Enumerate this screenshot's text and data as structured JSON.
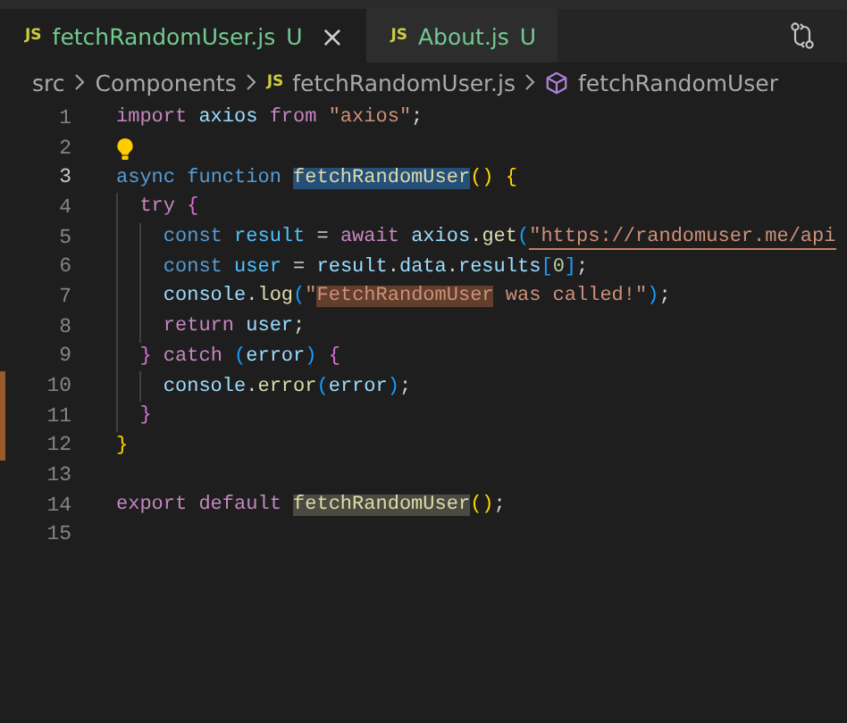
{
  "tabs": [
    {
      "lang": "JS",
      "label": "fetchRandomUser.js",
      "badge": "U",
      "selected": true,
      "close": "×"
    },
    {
      "lang": "JS",
      "label": "About.js",
      "badge": "U",
      "selected": false
    }
  ],
  "breadcrumb": [
    {
      "kind": "folder",
      "label": "src"
    },
    {
      "kind": "folder",
      "label": "Components"
    },
    {
      "kind": "file",
      "lang": "JS",
      "label": "fetchRandomUser.js"
    },
    {
      "kind": "symbol",
      "label": "fetchRandomUser"
    }
  ],
  "lines": [
    {
      "number": "1",
      "tokens": [
        {
          "kind": "kw",
          "t": "import"
        },
        {
          "kind": "var",
          "t": " axios"
        },
        {
          "kind": "kw",
          "t": " from"
        },
        {
          "kind": "str",
          "t": " \"axios\""
        },
        {
          "kind": "p",
          "t": ";"
        }
      ]
    },
    {
      "number": "2",
      "lightbulb": true
    },
    {
      "number": "3",
      "current": true,
      "tokens": [
        {
          "kind": "st",
          "t": "async"
        },
        {
          "kind": "st",
          "t": " function "
        },
        {
          "kind": "fn",
          "t": "fetchRandomUser",
          "selected": true
        },
        {
          "kind": "b1",
          "t": "()"
        },
        {
          "kind": "b1",
          "t": " {"
        }
      ]
    },
    {
      "number": "4",
      "tokens": [
        {
          "kind": "kw",
          "t": "  try"
        },
        {
          "kind": "b2",
          "t": " {"
        }
      ]
    },
    {
      "number": "5",
      "tokens": [
        {
          "kind": "st",
          "t": "    const"
        },
        {
          "kind": "cv",
          "t": " result"
        },
        {
          "kind": "p",
          "t": " = "
        },
        {
          "kind": "kw",
          "t": "await"
        },
        {
          "kind": "var",
          "t": " axios"
        },
        {
          "kind": "p",
          "t": "."
        },
        {
          "kind": "fn",
          "t": "get"
        },
        {
          "kind": "b3",
          "t": "("
        },
        {
          "kind": "str",
          "t": "\"https://randomuser.me/api",
          "underlined": true
        }
      ]
    },
    {
      "number": "6",
      "tokens": [
        {
          "kind": "st",
          "t": "    const"
        },
        {
          "kind": "cv",
          "t": " user"
        },
        {
          "kind": "p",
          "t": " = "
        },
        {
          "kind": "var",
          "t": "result"
        },
        {
          "kind": "p",
          "t": "."
        },
        {
          "kind": "var",
          "t": "data"
        },
        {
          "kind": "p",
          "t": "."
        },
        {
          "kind": "var",
          "t": "results"
        },
        {
          "kind": "b3",
          "t": "["
        },
        {
          "kind": "num",
          "t": "0"
        },
        {
          "kind": "b3",
          "t": "]"
        },
        {
          "kind": "p",
          "t": ";"
        }
      ]
    },
    {
      "number": "7",
      "tokens": [
        {
          "kind": "var",
          "t": "    console"
        },
        {
          "kind": "p",
          "t": "."
        },
        {
          "kind": "fn",
          "t": "log"
        },
        {
          "kind": "b3",
          "t": "("
        },
        {
          "kind": "str",
          "t": "\""
        },
        {
          "kind": "str",
          "t": "FetchRandomUser",
          "matched": true
        },
        {
          "kind": "str",
          "t": " was called!\""
        },
        {
          "kind": "b3",
          "t": ")"
        },
        {
          "kind": "p",
          "t": ";"
        }
      ]
    },
    {
      "number": "8",
      "tokens": [
        {
          "kind": "kw",
          "t": "    return"
        },
        {
          "kind": "var",
          "t": " user"
        },
        {
          "kind": "p",
          "t": ";"
        }
      ]
    },
    {
      "number": "9",
      "tokens": [
        {
          "kind": "b2",
          "t": "  }"
        },
        {
          "kind": "kw",
          "t": " catch"
        },
        {
          "kind": "b3",
          "t": " ("
        },
        {
          "kind": "var",
          "t": "error"
        },
        {
          "kind": "b3",
          "t": ")"
        },
        {
          "kind": "b2",
          "t": " {"
        }
      ]
    },
    {
      "number": "10",
      "changed": true,
      "tokens": [
        {
          "kind": "var",
          "t": "    console"
        },
        {
          "kind": "p",
          "t": "."
        },
        {
          "kind": "fn",
          "t": "error"
        },
        {
          "kind": "b3",
          "t": "("
        },
        {
          "kind": "var",
          "t": "error"
        },
        {
          "kind": "b3",
          "t": ")"
        },
        {
          "kind": "p",
          "t": ";"
        }
      ]
    },
    {
      "number": "11",
      "changed": true,
      "tokens": [
        {
          "kind": "b2",
          "t": "  }"
        }
      ]
    },
    {
      "number": "12",
      "changed": true,
      "tokens": [
        {
          "kind": "b1",
          "t": "}"
        }
      ]
    },
    {
      "number": "13"
    },
    {
      "number": "14",
      "tokens": [
        {
          "kind": "kw",
          "t": "export"
        },
        {
          "kind": "kw",
          "t": " default "
        },
        {
          "kind": "fn",
          "t": "fetchRandomUser",
          "occurrence": true
        },
        {
          "kind": "b1",
          "t": "()"
        },
        {
          "kind": "p",
          "t": ";"
        }
      ]
    },
    {
      "number": "15"
    }
  ]
}
